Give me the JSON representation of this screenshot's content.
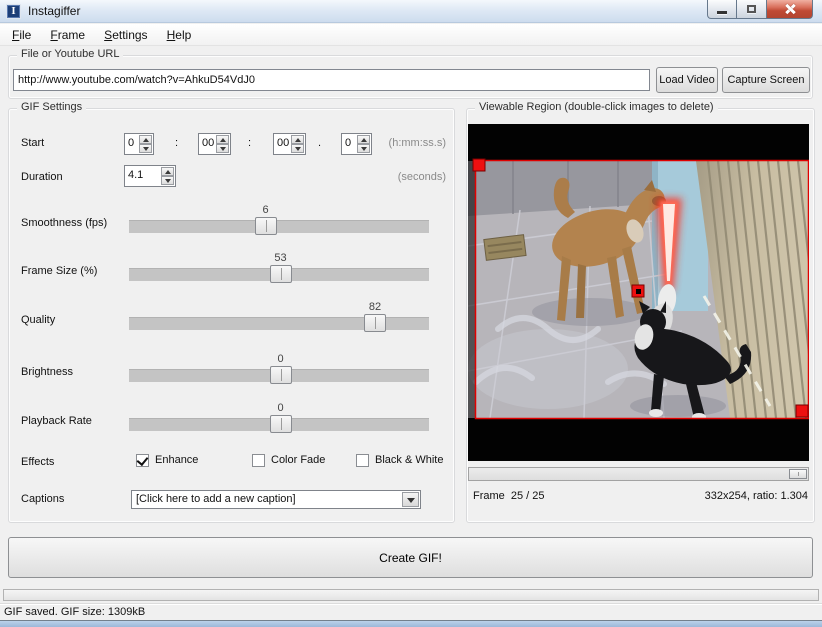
{
  "window": {
    "title": "Instagiffer",
    "icon_letter": "I"
  },
  "menu": {
    "items": [
      "File",
      "Frame",
      "Settings",
      "Help"
    ]
  },
  "url_section": {
    "label": "File or Youtube URL",
    "url": "http://www.youtube.com/watch?v=AhkuD54VdJ0",
    "load_button": "Load Video",
    "capture_button": "Capture Screen"
  },
  "gif_settings": {
    "label": "GIF Settings",
    "start": {
      "label": "Start",
      "hours": "0",
      "minutes": "00",
      "seconds": "00",
      "tenths": "0",
      "sep1": ":",
      "sep2": ":",
      "sep3": ".",
      "hint": "(h:mm:ss.s)"
    },
    "duration": {
      "label": "Duration",
      "value": "4.1",
      "hint": "(seconds)"
    },
    "sliders": [
      {
        "label": "Smoothness (fps)",
        "value": "6",
        "percent": 45.5
      },
      {
        "label": "Frame Size (%)",
        "value": "53",
        "percent": 50.5
      },
      {
        "label": "Quality",
        "value": "82",
        "percent": 82
      },
      {
        "label": "Brightness",
        "value": "0",
        "percent": 50.5
      },
      {
        "label": "Playback Rate",
        "value": "0",
        "percent": 50.5
      }
    ],
    "effects": {
      "label": "Effects",
      "options": [
        {
          "label": "Enhance",
          "checked": true
        },
        {
          "label": "Color Fade",
          "checked": false
        },
        {
          "label": "Black & White",
          "checked": false
        }
      ]
    },
    "captions": {
      "label": "Captions",
      "value": "[Click here to add a new caption]"
    }
  },
  "viewable_region": {
    "label": "Viewable Region (double-click images to delete)",
    "frame_label": "Frame  25 / 25",
    "size_label": "332x254, ratio: 1.304"
  },
  "create_button": "Create GIF!",
  "status_bar": "GIF saved. GIF size: 1309kB",
  "colors": {
    "selection_red": "#ee1010",
    "saber_red": "#ff3b2a",
    "close_button_red": "#c04a34",
    "dog_tan": "#b3834e",
    "window_bg": "#f0f0f0"
  }
}
